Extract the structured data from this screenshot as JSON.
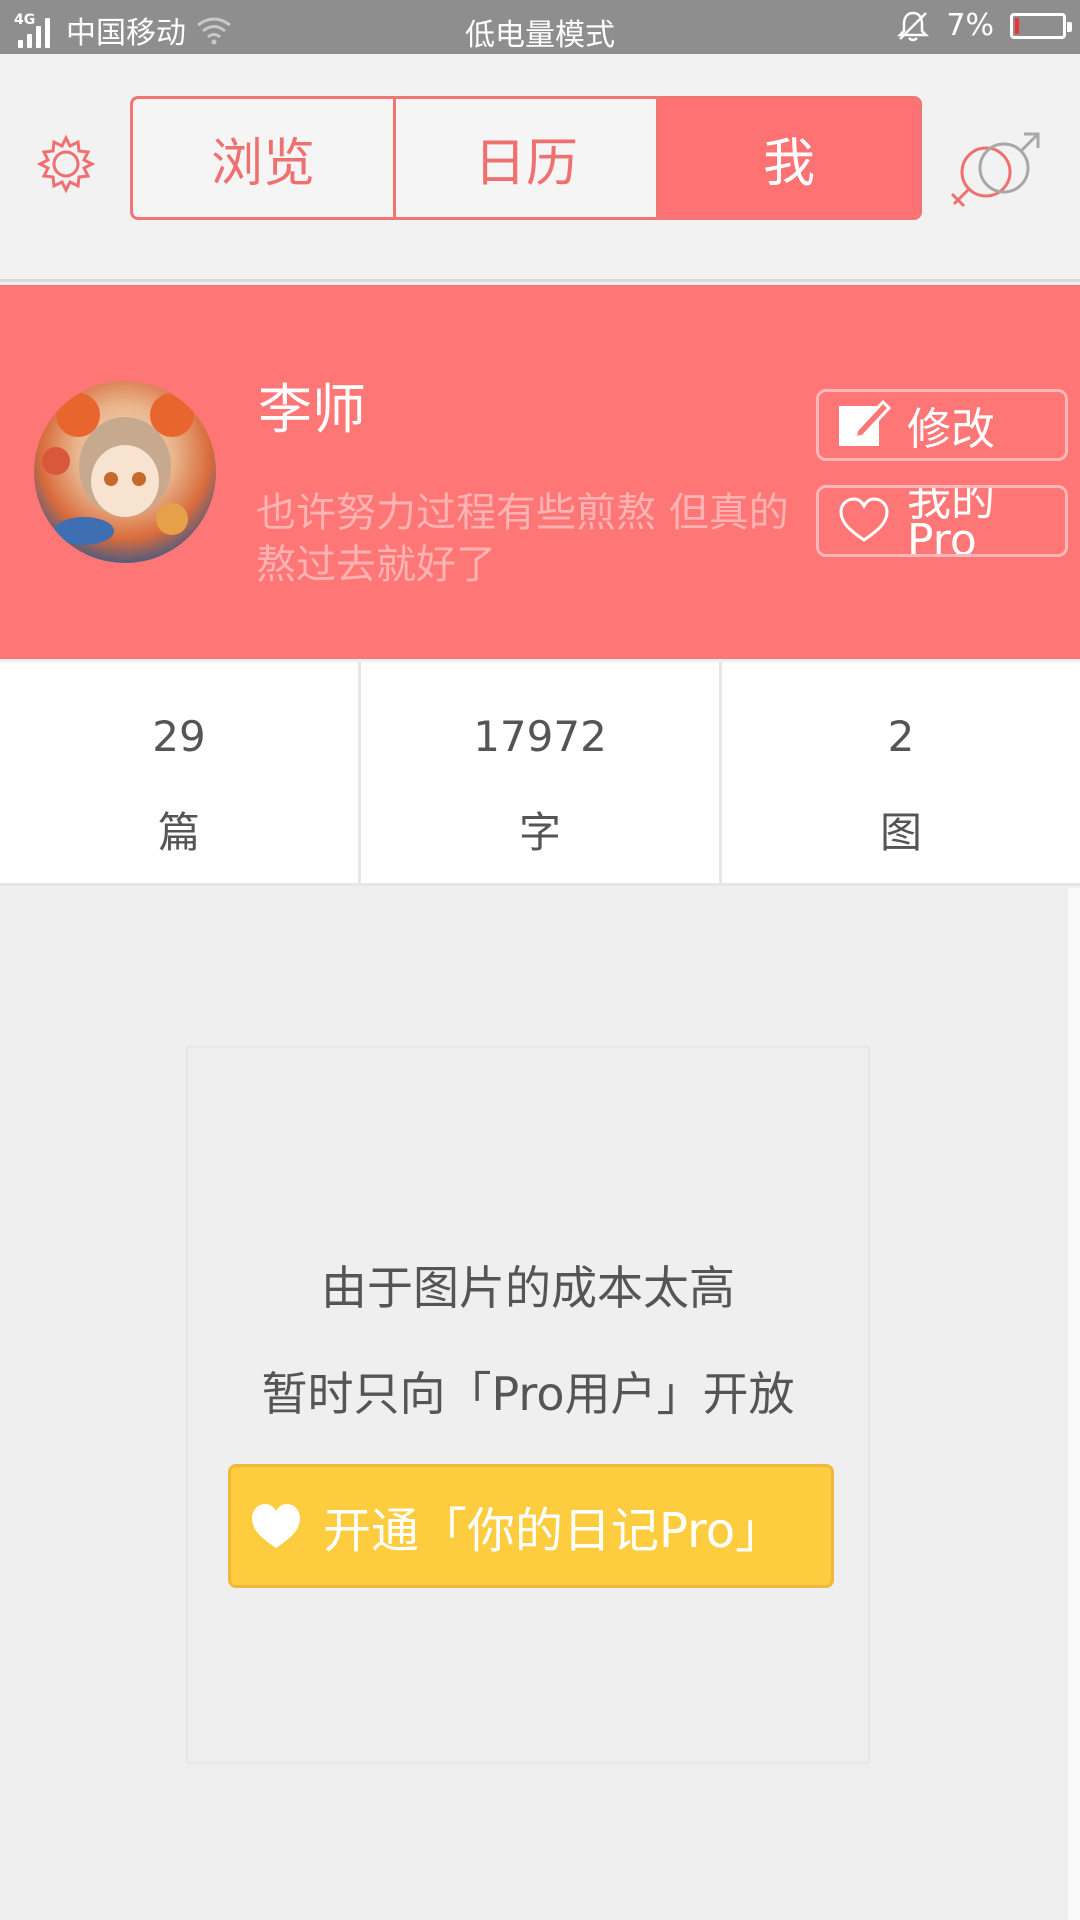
{
  "status_bar": {
    "network_tag": "4G",
    "carrier": "中国移动",
    "mode": "低电量模式",
    "battery": "7%",
    "battery_level": 0.07
  },
  "nav": {
    "tabs": [
      {
        "label": "浏览",
        "active": false
      },
      {
        "label": "日历",
        "active": false
      },
      {
        "label": "我",
        "active": true
      }
    ]
  },
  "profile": {
    "name": "李师",
    "motto": "也许努力过程有些煎熬 但真的熬过去就好了",
    "edit_label": "修改",
    "pro_label": "我的Pro"
  },
  "stats": [
    {
      "value": "29",
      "unit": "篇"
    },
    {
      "value": "17972",
      "unit": "字"
    },
    {
      "value": "2",
      "unit": "图"
    }
  ],
  "locked": {
    "line1": "由于图片的成本太高",
    "line2": "暂时只向「Pro用户」开放",
    "button_label": "开通「你的日记Pro」"
  },
  "colors": {
    "accent": "#ff7677",
    "pro_button": "#fdcd3f",
    "status_bar": "#8e8e8e"
  },
  "icons": [
    "signal-icon",
    "wifi-icon",
    "bell-off-icon",
    "battery-icon",
    "gear-icon",
    "gender-icon",
    "edit-icon",
    "heart-icon"
  ]
}
